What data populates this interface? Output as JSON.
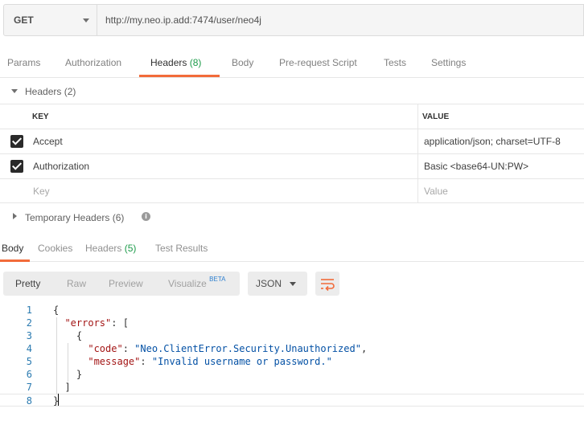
{
  "request": {
    "method": "GET",
    "url": "http://my.neo.ip.add:7474/user/neo4j"
  },
  "req_tabs": {
    "params": "Params",
    "authorization": "Authorization",
    "headers": "Headers",
    "headers_count": "(8)",
    "body": "Body",
    "prerequest": "Pre-request Script",
    "tests": "Tests",
    "settings": "Settings"
  },
  "headers_section": {
    "title": "Headers (2)",
    "columns": {
      "key": "KEY",
      "value": "VALUE"
    },
    "rows": [
      {
        "key": "Accept",
        "value": "application/json; charset=UTF-8",
        "checked": true
      },
      {
        "key": "Authorization",
        "value": "Basic <base64-UN:PW>",
        "checked": true
      }
    ],
    "placeholder_key": "Key",
    "placeholder_value": "Value"
  },
  "temp_headers": {
    "title": "Temporary Headers",
    "count": "(6)",
    "info_glyph": "i"
  },
  "resp_tabs": {
    "body": "Body",
    "cookies": "Cookies",
    "headers": "Headers",
    "headers_count": "(5)",
    "test_results": "Test Results"
  },
  "body_toolbar": {
    "pretty": "Pretty",
    "raw": "Raw",
    "preview": "Preview",
    "visualize": "Visualize",
    "beta": "BETA",
    "format": "JSON"
  },
  "code_lines": [
    {
      "num": "1",
      "text": "{"
    },
    {
      "num": "2",
      "text": "  \"errors\": ["
    },
    {
      "num": "3",
      "text": "    {"
    },
    {
      "num": "4",
      "text": "      \"code\": \"Neo.ClientError.Security.Unauthorized\","
    },
    {
      "num": "5",
      "text": "      \"message\": \"Invalid username or password.\""
    },
    {
      "num": "6",
      "text": "    }"
    },
    {
      "num": "7",
      "text": "  ]"
    },
    {
      "num": "8",
      "text": "}"
    }
  ],
  "colors": {
    "accent": "#f26b3a",
    "count_green": "#1c9b4a",
    "line_number": "#2a7ab0",
    "json_key": "#a31515",
    "json_string": "#0451a5"
  }
}
